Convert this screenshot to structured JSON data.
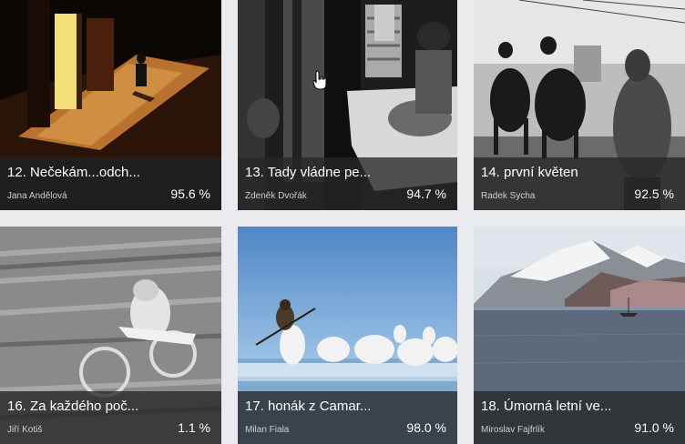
{
  "gallery": {
    "cards": [
      {
        "title": "12. Nečekám...odch...",
        "author": "Jana Andělová",
        "score": "95.6 %"
      },
      {
        "title": "13. Tady vládne pe...",
        "author": "Zdeněk Dvořák",
        "score": "94.7 %"
      },
      {
        "title": "14. první květen",
        "author": "Radek Sycha",
        "score": "92.5 %"
      },
      {
        "title": "16. Za každého poč...",
        "author": "Jiří Kotiš",
        "score": "1.1 %"
      },
      {
        "title": "17. honák z Camar...",
        "author": "Milan Fiala",
        "score": "98.0 %"
      },
      {
        "title": "18. Úmorná letní ve...",
        "author": "Miroslav Fajfrlík",
        "score": "91.0 %"
      }
    ]
  },
  "icons": {
    "cursor": "hand-pointer-icon"
  }
}
